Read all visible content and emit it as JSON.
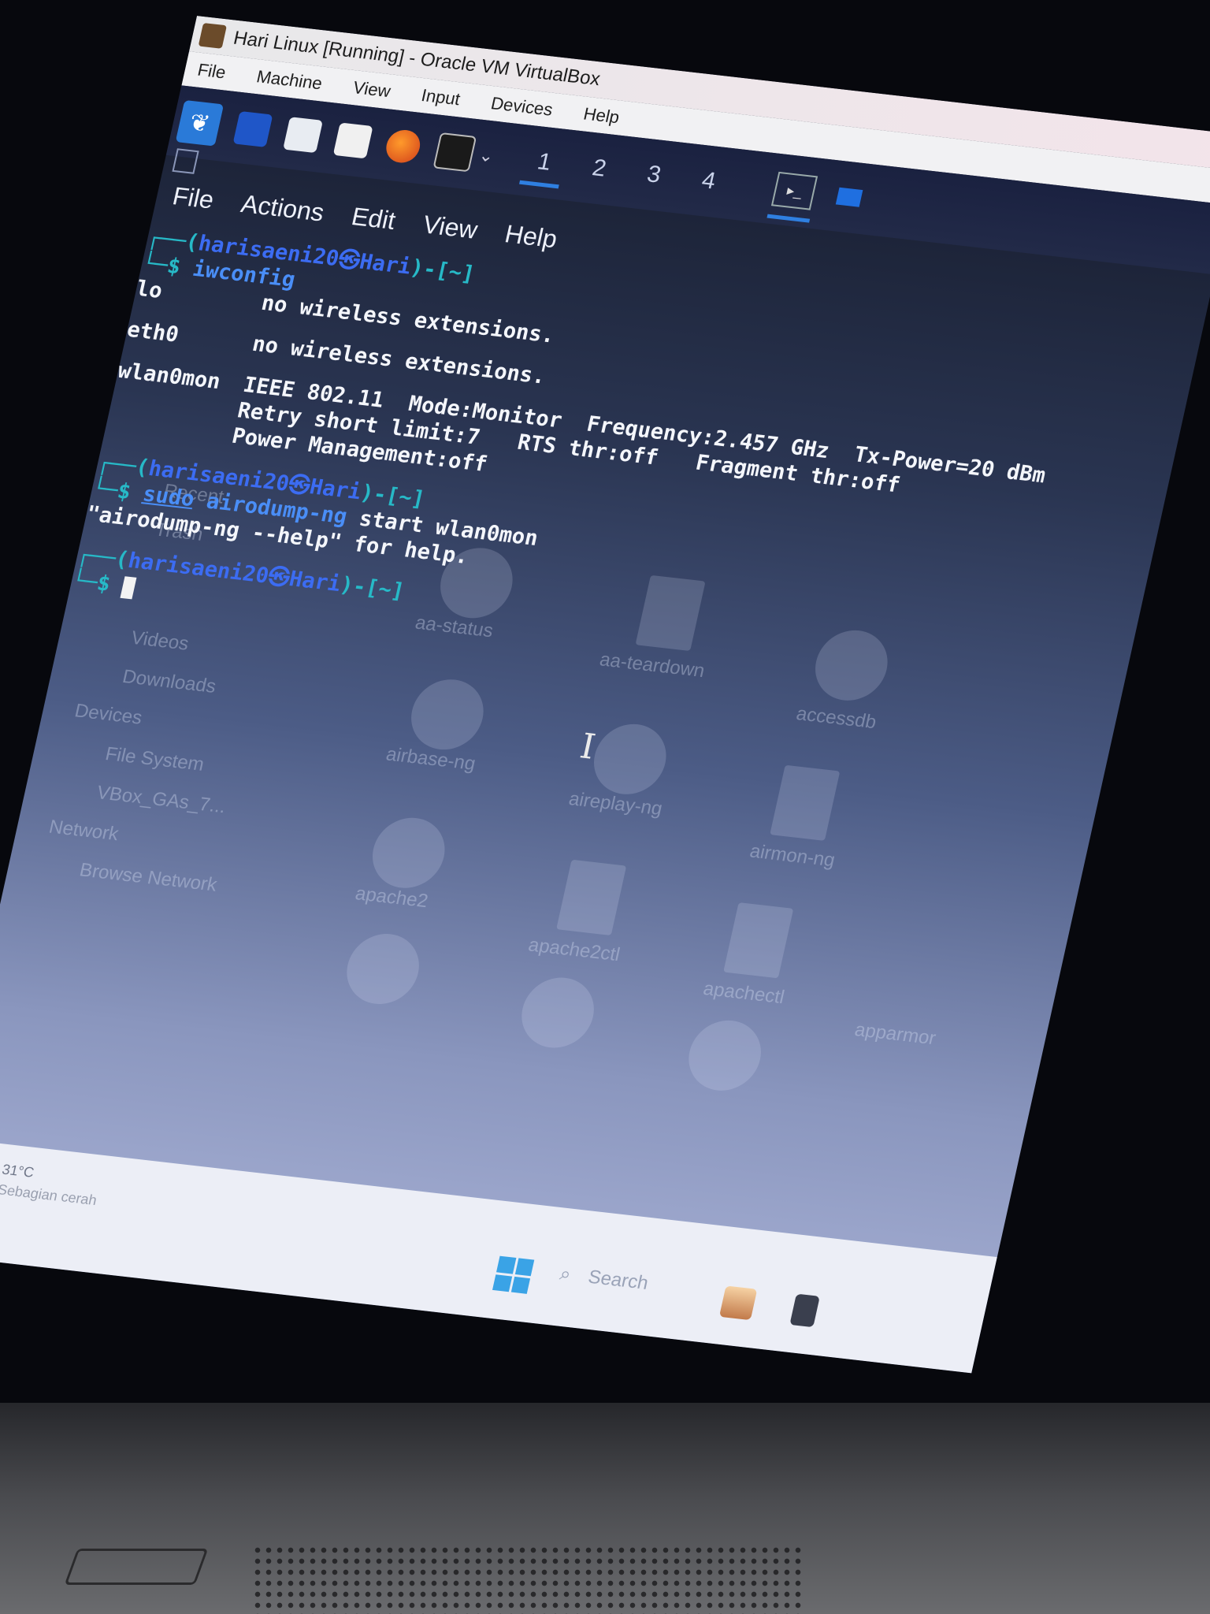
{
  "vbox": {
    "title": "Hari Linux [Running] - Oracle VM VirtualBox",
    "menu": [
      "File",
      "Machine",
      "View",
      "Input",
      "Devices",
      "Help"
    ]
  },
  "kali_panel": {
    "workspaces": [
      "1",
      "2",
      "3",
      "4"
    ],
    "active_workspace": "1"
  },
  "terminal_menu": [
    "File",
    "Actions",
    "Edit",
    "View",
    "Help"
  ],
  "prompt": {
    "corner_top": "┌──(",
    "user_host": "harisaeni20㉿Hari",
    "path": ")-[~]",
    "corner_bottom": "└─",
    "dollar": "$ "
  },
  "session": {
    "cmd1": "iwconfig",
    "out1": [
      {
        "iface": "lo",
        "text": "no wireless extensions."
      },
      {
        "iface": "eth0",
        "text": "no wireless extensions."
      }
    ],
    "wlan_iface": "wlan0mon",
    "wlan_lines": [
      "IEEE 802.11  Mode:Monitor  Frequency:2.457 GHz  Tx-Power=20 dBm",
      "Retry short limit:7   RTS thr:off   Fragment thr:off",
      "Power Management:off"
    ],
    "cmd2_sudo": "sudo",
    "cmd2_rest": " airodump-ng",
    "cmd2_args": " start wlan0mon",
    "out2": "\"airodump-ng --help\" for help."
  },
  "desktop_ghost": {
    "labels": [
      "Recent",
      "Trash",
      "Videos",
      "Downloads",
      "Devices",
      "File System",
      "VBox_GAs_7...",
      "Network",
      "Browse Network",
      "aa-status",
      "aa-teardown",
      "accessdb",
      "airbase-ng",
      "aireplay-ng",
      "airmon-ng",
      "apache2",
      "apache2ctl",
      "apachectl",
      "apparmor"
    ]
  },
  "windows_taskbar": {
    "weather_temp": "31°C",
    "weather_desc": "Sebagian cerah",
    "search_placeholder": "Search"
  }
}
